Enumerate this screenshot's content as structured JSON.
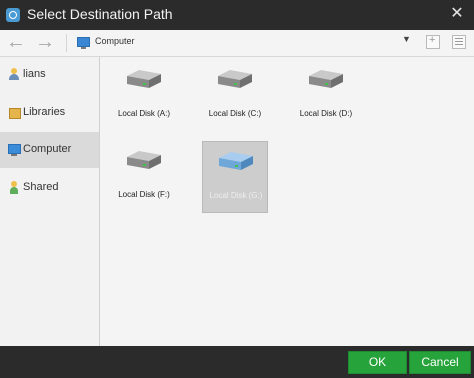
{
  "window": {
    "title": "Select Destination Path",
    "close_icon": "close-icon"
  },
  "toolbar": {
    "back_icon": "back-arrow-icon",
    "forward_icon": "forward-arrow-icon",
    "path_icon": "computer-icon",
    "path_text": "Computer",
    "dropdown_glyph": "▼",
    "new_folder_icon": "new-folder-icon",
    "view_icon": "view-list-icon"
  },
  "sidebar": {
    "items": [
      {
        "label": "lians",
        "icon": "user-icon"
      },
      {
        "label": "Libraries",
        "icon": "library-icon"
      },
      {
        "label": "Computer",
        "icon": "computer-icon",
        "selected": true
      },
      {
        "label": "Shared",
        "icon": "shared-icon"
      }
    ]
  },
  "main": {
    "disks": [
      {
        "label": "Local Disk (A:)",
        "icon": "disk-icon"
      },
      {
        "label": "Local Disk (C:)",
        "icon": "disk-icon"
      },
      {
        "label": "Local Disk (D:)",
        "icon": "disk-icon"
      },
      {
        "label": "Local Disk (F:)",
        "icon": "disk-icon"
      },
      {
        "label": "Local Disk (G:)",
        "icon": "disk-icon",
        "selected": true
      }
    ]
  },
  "footer": {
    "ok_label": "OK",
    "cancel_label": "Cancel"
  },
  "colors": {
    "titlebar": "#2b2b2b",
    "accent_green": "#26a43b",
    "selected_item": "#dadada",
    "disk_selected_blue": "#6fa7d8"
  }
}
